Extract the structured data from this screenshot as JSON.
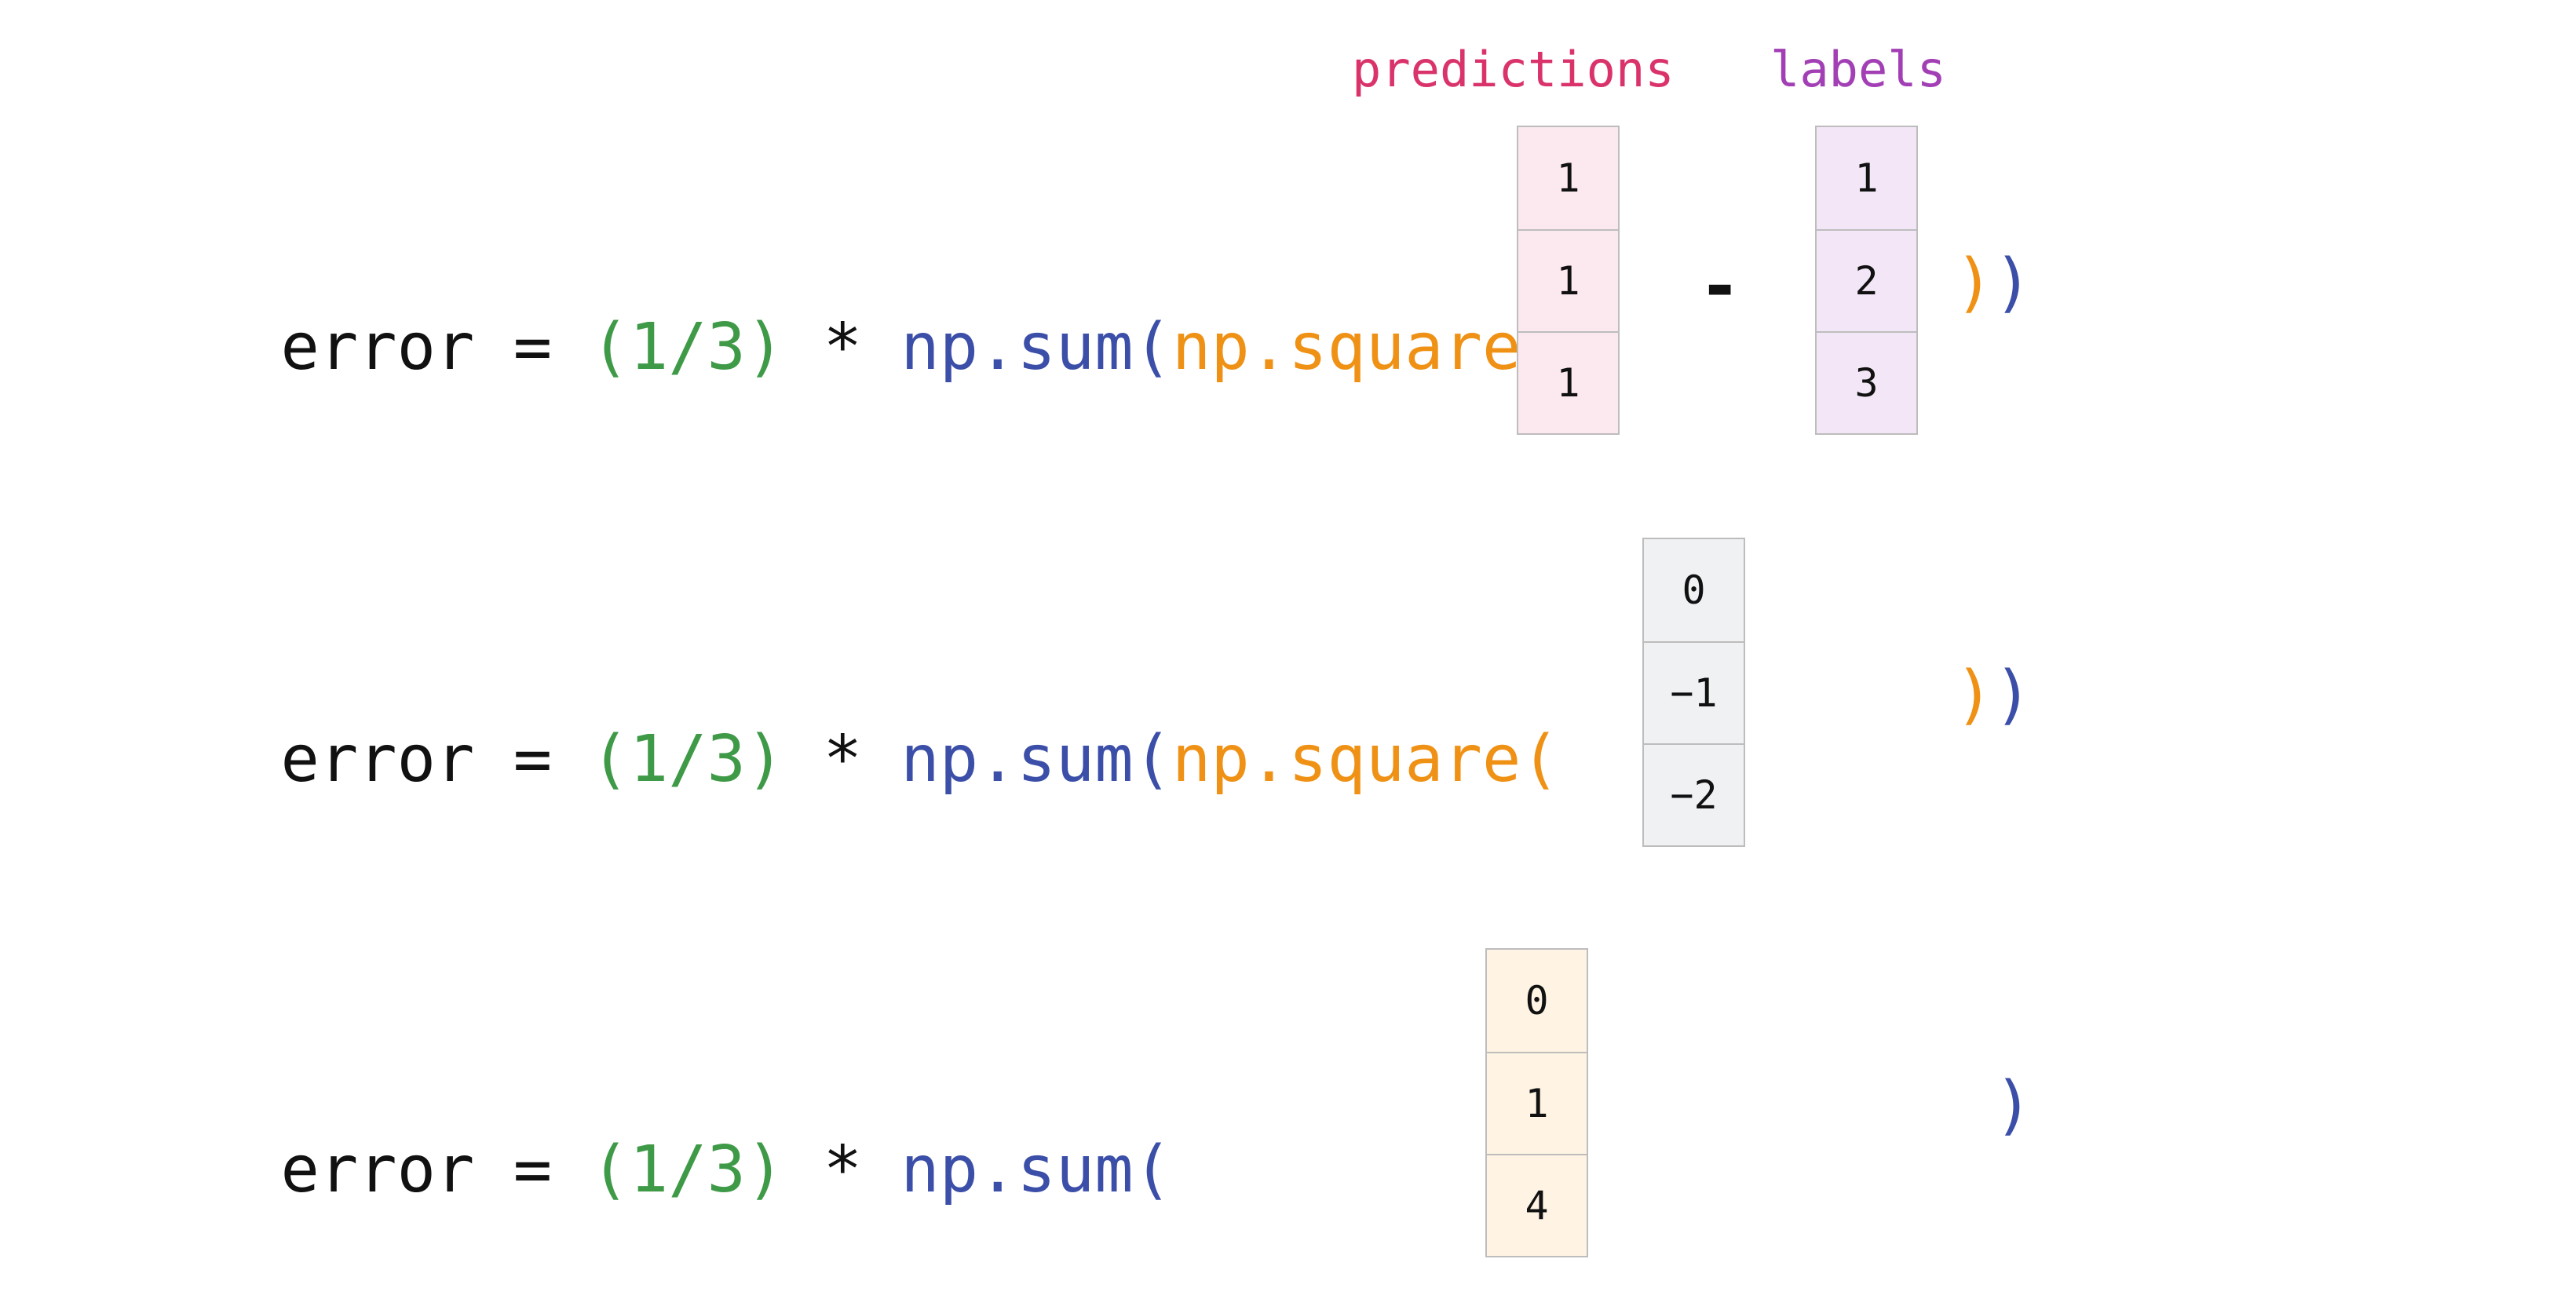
{
  "code": {
    "error": "error",
    "equals": "=",
    "scale": "(1/3)",
    "times": "*",
    "sum_open": "np.sum(",
    "square_open": "np.square(",
    "square_close": ")",
    "sum_close": ")",
    "minus": "-"
  },
  "labels": {
    "predictions": "predictions",
    "labels": "labels"
  },
  "arrays": {
    "predictions": [
      "1",
      "1",
      "1"
    ],
    "labels": [
      "1",
      "2",
      "3"
    ],
    "difference": [
      "0",
      "−1",
      "−2"
    ],
    "squared": [
      "0",
      "1",
      "4"
    ]
  },
  "colors": {
    "text": "#111111",
    "number_group": "#3f9a48",
    "np_sum": "#3c4fa8",
    "np_square": "#ef9115",
    "predictions_label": "#d9336a",
    "labels_label": "#a23fb5",
    "predictions_fill": "#fce8ef",
    "labels_fill": "#f3e6f7",
    "difference_fill": "#f0f1f3",
    "squared_fill": "#fff4e3"
  }
}
